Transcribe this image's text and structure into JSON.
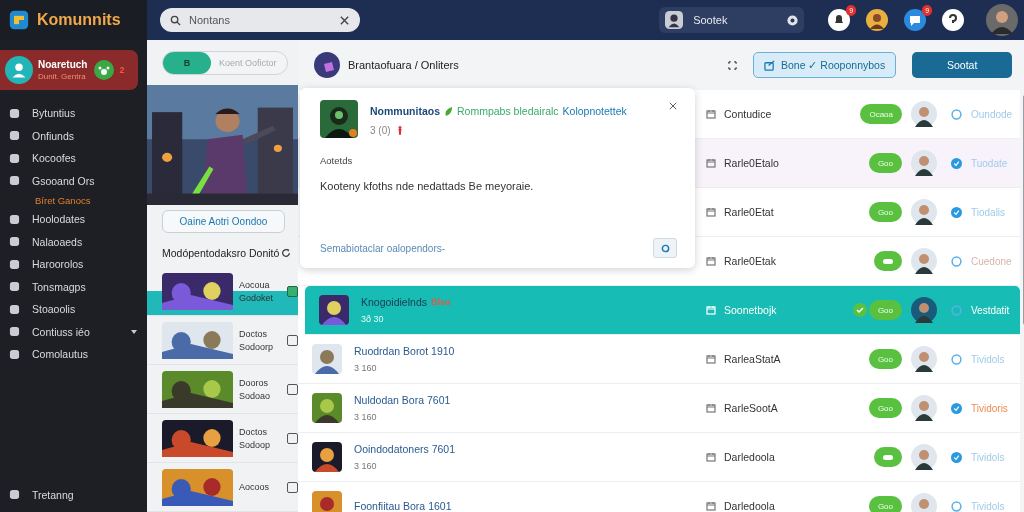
{
  "app": {
    "name": "Komunnits"
  },
  "profile": {
    "name": "Noaretuch",
    "subtitle": "Dunit. Gentra",
    "badge": "2"
  },
  "nav": [
    {
      "label": "Bytuntius",
      "kind": "item"
    },
    {
      "label": "Onfiunds",
      "kind": "item"
    },
    {
      "label": "Kocoofes",
      "kind": "item"
    },
    {
      "label": "Gsooand Ors",
      "kind": "item"
    },
    {
      "label": "Bíret Ganocs",
      "kind": "sub"
    },
    {
      "label": "Hoolodates",
      "kind": "item"
    },
    {
      "label": "Nalaoaeds",
      "kind": "item"
    },
    {
      "label": "Haroorolos",
      "kind": "item"
    },
    {
      "label": "Tonsmagps",
      "kind": "item"
    },
    {
      "label": "Stoaoolis",
      "kind": "item"
    },
    {
      "label": "Contiuss iéo",
      "kind": "expand"
    },
    {
      "label": "Comolautus",
      "kind": "item"
    }
  ],
  "nav_footer": "Tretanng",
  "topbar": {
    "search_placeholder": "Nontans",
    "search2_placeholder": "Sootek",
    "badges": [
      "9",
      "9"
    ]
  },
  "left_panel": {
    "toggle": [
      {
        "label": "B",
        "selected": true
      },
      {
        "label": "Koent Oofictor",
        "selected": false
      }
    ],
    "button": "Oaine Aotri Oondoo",
    "heading": "Modópentodaksro Donitó",
    "games": [
      {
        "line1": "Aocoua",
        "line2": "Godoket",
        "checked": true
      },
      {
        "line1": "Doctos",
        "line2": "Sodoorp",
        "checked": false
      },
      {
        "line1": "Dooros",
        "line2": "Sodoao",
        "checked": false
      },
      {
        "line1": "Doctos",
        "line2": "Sodoop",
        "checked": false
      },
      {
        "line1": "Aocoos",
        "checked": false
      }
    ]
  },
  "header": {
    "breadcrumb": "Brantaofuara / Onliters",
    "button1": "Bone ✓ Rooponnybos",
    "button2": "Sootat"
  },
  "popup": {
    "title": "Nommunitaos",
    "tag": "Rommpabs bledairalc",
    "tag2": "Kolopnotettek",
    "meta": "3 (0)",
    "section": "Aotetds",
    "text": "Kooteny kfoths nde nedattads Be meyoraie.",
    "link": "Semabiotaclar oalopendors-"
  },
  "rows": [
    {
      "selected": false,
      "label": "Contudice",
      "pill": "Ocaoa",
      "checked": false,
      "status_on": false,
      "status": "Oundode",
      "color": "#9fcbe8"
    },
    {
      "selected": false,
      "label": "Rarle0Etalo",
      "pill": "Goo",
      "checked": false,
      "status_on": true,
      "status": "Tuodate",
      "color": "#9fcbe8"
    },
    {
      "selected": false,
      "label": "Rarle0Etat",
      "pill": "Goo",
      "checked": false,
      "status_on": true,
      "status": "Tiodalis",
      "color": "#9fcbe8"
    },
    {
      "selected": false,
      "label": "Rarle0Etak",
      "checked": false,
      "status_on": false,
      "status": "Cuedone",
      "color": "#d6b4ac"
    },
    {
      "selected": true,
      "title": "Knogoidielnds",
      "badge": "Blsu",
      "sub": "3ð 30",
      "label": "Soonetbojk",
      "pill": "Goo",
      "checked": true,
      "status_on": false,
      "status": "Vestdatit",
      "color": "#ffffff"
    },
    {
      "selected": false,
      "title": "Ruodrdan Borot 1910",
      "sub": "3 160",
      "label": "RarleaStatA",
      "pill": "Goo",
      "checked": false,
      "status_on": false,
      "status": "Tividols",
      "color": "#9fcbe8"
    },
    {
      "selected": false,
      "title": "Nuldodan Bora 7601",
      "sub": "3 160",
      "label": "RarleSootA",
      "pill": "Goo",
      "checked": false,
      "status_on": true,
      "status": "Tividoris",
      "color": "#f08a50"
    },
    {
      "selected": false,
      "title": "Ooindodatoners 7601",
      "sub": "3 160",
      "label": "Darledoola",
      "checked": false,
      "status_on": true,
      "status": "Tividols",
      "color": "#9fcbe8"
    },
    {
      "selected": false,
      "title": "Foonfiitau Bora 1601",
      "label": "Darledoola",
      "pill": "Goo",
      "checked": false,
      "status_on": false,
      "status": "Tividols",
      "color": "#9fcbe8"
    }
  ]
}
